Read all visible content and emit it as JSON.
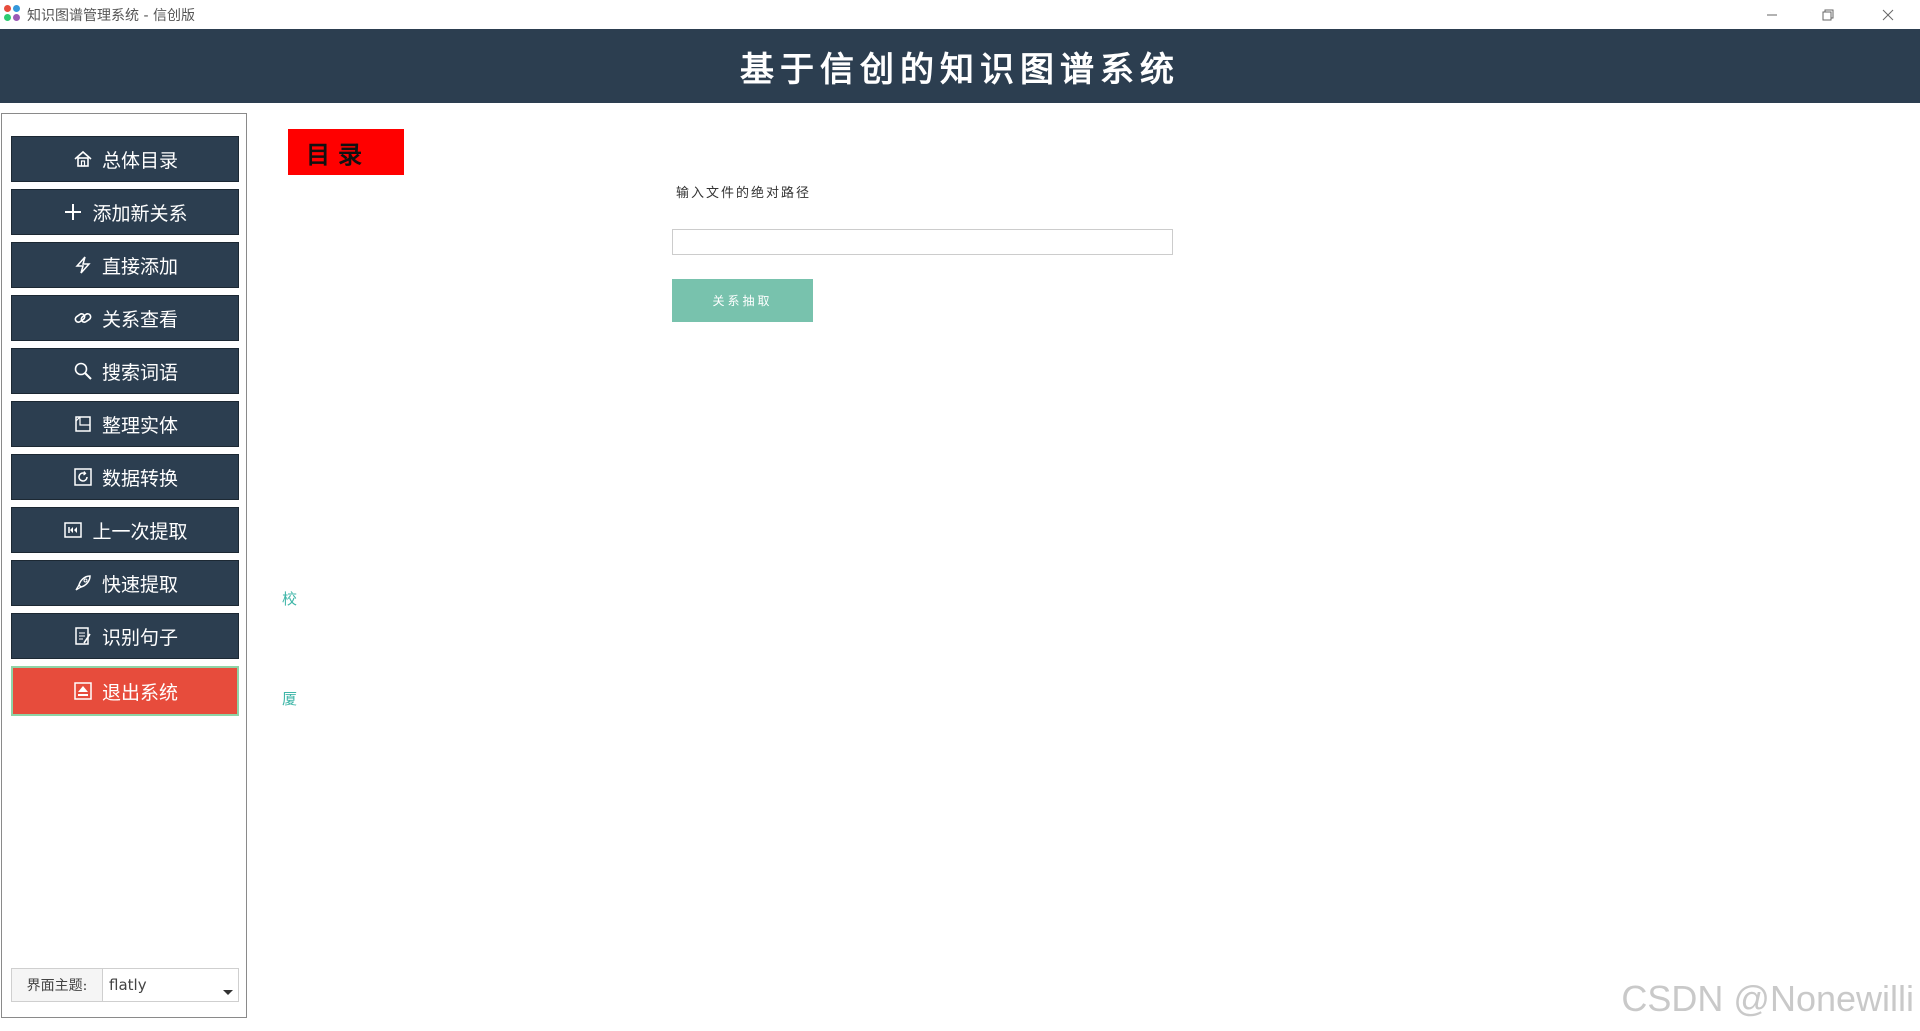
{
  "window": {
    "title": "知识图谱管理系统 - 信创版",
    "controls": [
      "minimize-icon",
      "restore-icon",
      "close-icon"
    ]
  },
  "header": {
    "title": "基于信创的知识图谱系统",
    "background": "#2c3e50"
  },
  "sidebar": {
    "items": [
      {
        "label": "总体目录",
        "icon": "home-icon"
      },
      {
        "label": "添加新关系",
        "icon": "plus-icon"
      },
      {
        "label": "直接添加",
        "icon": "lightning-icon"
      },
      {
        "label": "关系查看",
        "icon": "link-icon"
      },
      {
        "label": "搜索词语",
        "icon": "search-icon"
      },
      {
        "label": "整理实体",
        "icon": "cube-icon"
      },
      {
        "label": "数据转换",
        "icon": "refresh-icon"
      },
      {
        "label": "上一次提取",
        "icon": "rewind-icon"
      },
      {
        "label": "快速提取",
        "icon": "rocket-icon"
      },
      {
        "label": "识别句子",
        "icon": "edit-document-icon"
      },
      {
        "label": "退出系统",
        "icon": "eject-icon"
      }
    ],
    "theme": {
      "label": "界面主题:",
      "value": "flatly"
    }
  },
  "main": {
    "catalog_label": "目录",
    "path_label": "输入文件的绝对路径",
    "path_value": "",
    "extract_button": "关系抽取",
    "side_notes": [
      "校",
      "厦"
    ]
  },
  "watermark": "CSDN @Nonewilli",
  "colors": {
    "primary": "#2c3e50",
    "danger": "#e74c3c",
    "success": "#78c2ad",
    "badge": "#ff0000"
  }
}
